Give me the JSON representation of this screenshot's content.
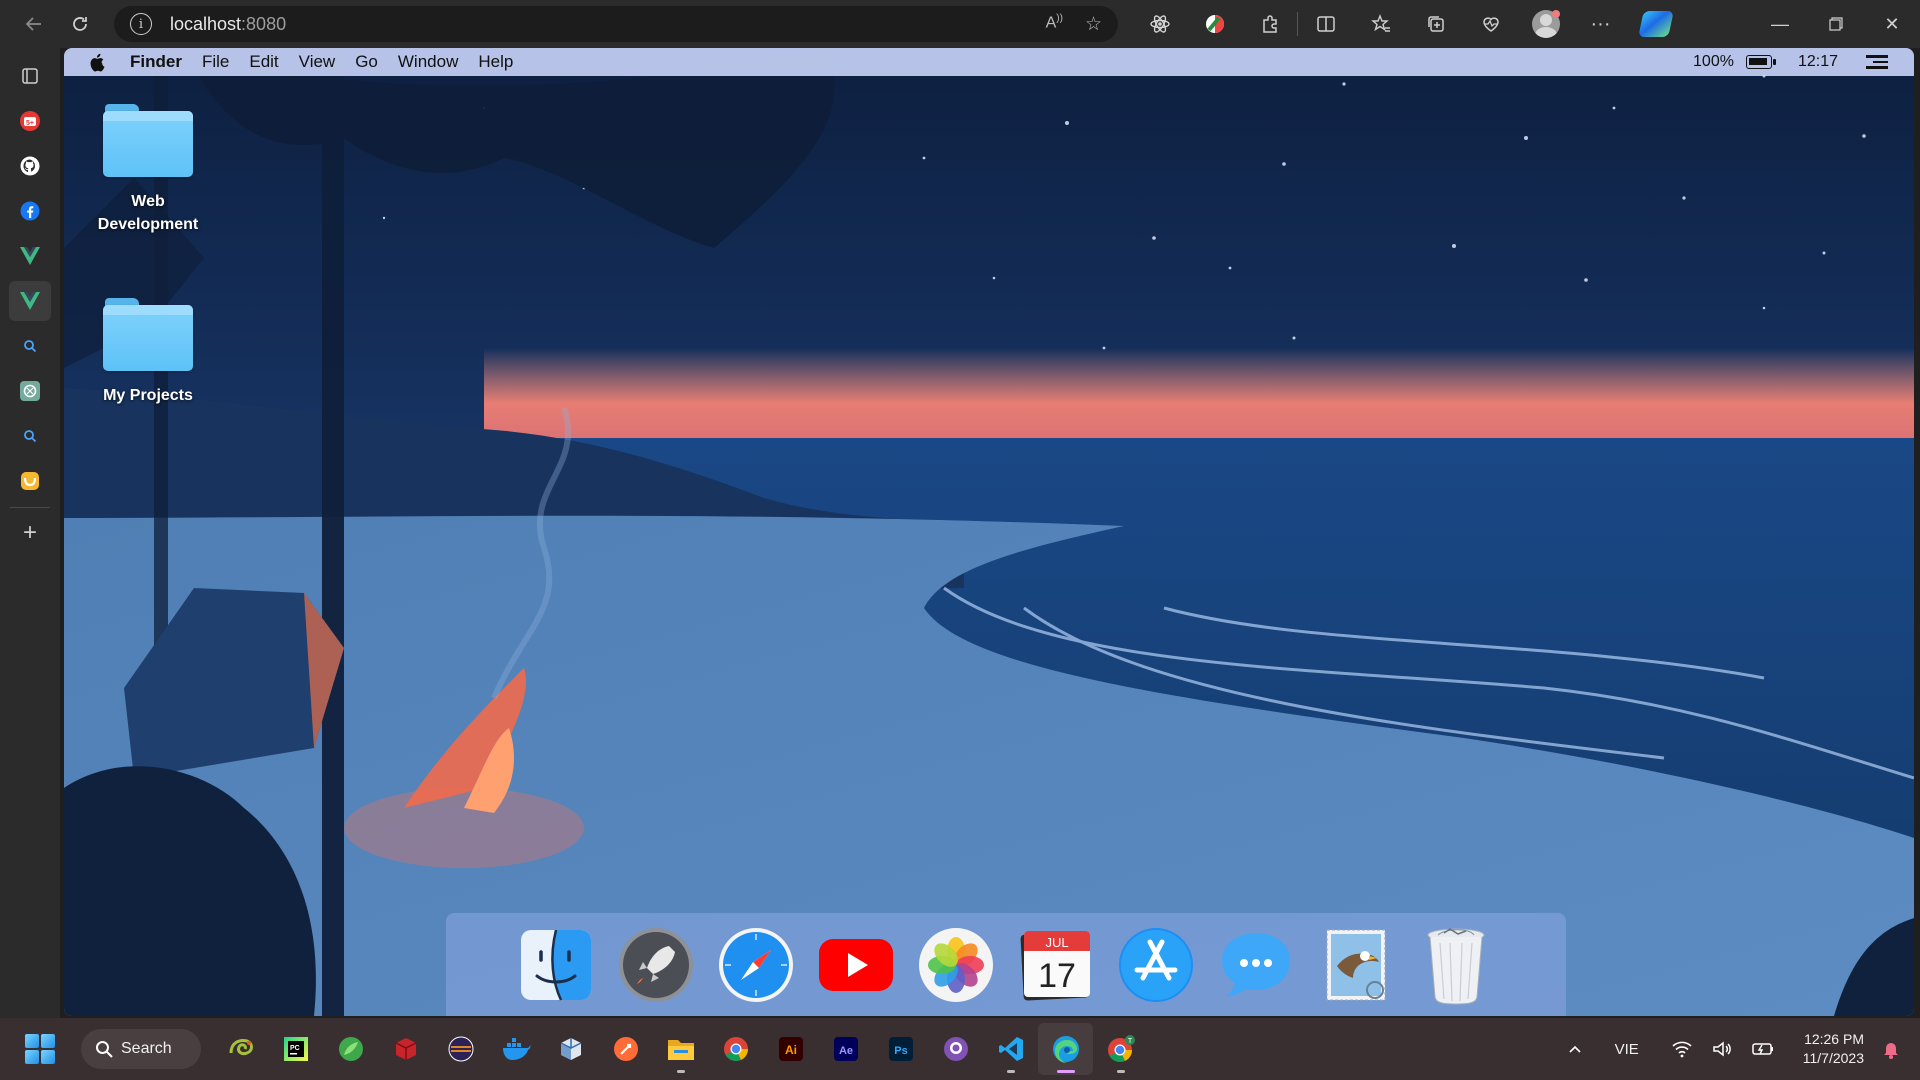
{
  "browser": {
    "url_host": "localhost",
    "url_port": ":8080",
    "toolbar_icons": [
      "react-devtools-icon",
      "color-extension-icon",
      "extensions-icon",
      "split-screen-icon",
      "favorites-icon",
      "collections-icon",
      "browser-essentials-icon",
      "profile-icon",
      "more-icon",
      "copilot-icon"
    ]
  },
  "sidebar": {
    "items": [
      "tab-actions-icon",
      "shopping-extension-icon",
      "github-icon",
      "facebook-icon",
      "vue-icon",
      "vue-icon",
      "search-icon",
      "chatgpt-icon",
      "search-icon",
      "extension-icon",
      "add-icon"
    ]
  },
  "menubar": {
    "app_name": "Finder",
    "items": [
      "File",
      "Edit",
      "View",
      "Go",
      "Window",
      "Help"
    ],
    "battery_percent": "100%",
    "time": "12:17"
  },
  "desktop": {
    "icons": [
      {
        "label_line1": "Web",
        "label_line2": "Development"
      },
      {
        "label_line1": "My Projects",
        "label_line2": ""
      }
    ]
  },
  "dock": {
    "apps": [
      "finder-icon",
      "launchpad-icon",
      "safari-icon",
      "youtube-icon",
      "photos-icon",
      "calendar-icon",
      "app-store-icon",
      "messages-icon",
      "mail-icon",
      "trash-icon"
    ],
    "calendar_month": "JUL",
    "calendar_day": "17"
  },
  "taskbar": {
    "search_label": "Search",
    "language": "VIE",
    "time": "12:26 PM",
    "date": "11/7/2023"
  },
  "colors": {
    "menubar": "#c4d0f5",
    "sky_top": "#0e2242",
    "horizon_glow": "#ff8a7a",
    "sea": "#1d4b86",
    "taskbar": "#3a2f30"
  }
}
